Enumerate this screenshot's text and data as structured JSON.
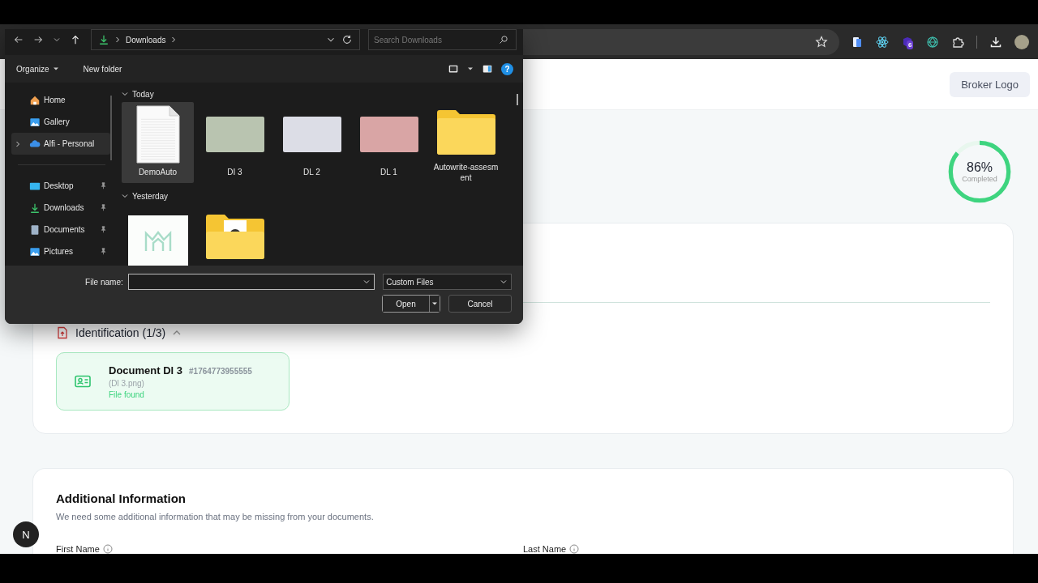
{
  "browser_toolbar": {
    "extension_badge": "6"
  },
  "dialog": {
    "breadcrumb": [
      "Downloads"
    ],
    "search": {
      "placeholder": "Search Downloads"
    },
    "toolbar": {
      "organize": "Organize",
      "new_folder": "New folder",
      "help": "?"
    },
    "sidebar": [
      {
        "label": "Home",
        "kind": "home",
        "pinned": false,
        "selected": false,
        "expandable": false
      },
      {
        "label": "Gallery",
        "kind": "gallery",
        "pinned": false,
        "selected": false,
        "expandable": false
      },
      {
        "label": "Alfi - Personal",
        "kind": "cloud",
        "pinned": false,
        "selected": true,
        "expandable": true
      },
      {
        "label": "Desktop",
        "kind": "desktop",
        "pinned": true,
        "selected": false,
        "expandable": false
      },
      {
        "label": "Downloads",
        "kind": "download",
        "pinned": true,
        "selected": false,
        "expandable": false
      },
      {
        "label": "Documents",
        "kind": "documents",
        "pinned": true,
        "selected": false,
        "expandable": false
      },
      {
        "label": "Pictures",
        "kind": "gallery",
        "pinned": true,
        "selected": false,
        "expandable": false
      }
    ],
    "groups": [
      {
        "title": "Today",
        "expanded": true,
        "items": [
          {
            "name": "DemoAuto",
            "kind": "document",
            "selected": true
          },
          {
            "name": "DI 3",
            "kind": "id-card",
            "selected": false,
            "color": "#b9c4b0"
          },
          {
            "name": "DL 2",
            "kind": "id-card",
            "selected": false,
            "color": "#dcdde6"
          },
          {
            "name": "DL 1",
            "kind": "id-card",
            "selected": false,
            "color": "#d9a5a5"
          },
          {
            "name": "Autowrite-assesment",
            "kind": "folder",
            "selected": false
          }
        ]
      },
      {
        "title": "Yesterday",
        "expanded": true,
        "items": [
          {
            "kind": "logo-image",
            "selected": false
          },
          {
            "kind": "folder-with-file",
            "selected": false
          }
        ]
      }
    ],
    "file_name": {
      "label": "File name:"
    },
    "file_type": "Custom Files",
    "buttons": {
      "open": "Open",
      "cancel": "Cancel"
    }
  },
  "page": {
    "broker_logo": "Broker Logo",
    "progress": {
      "level": 0.86,
      "percent": "86%",
      "caption": "Completed"
    },
    "identification": {
      "title": "Identification (1/3)",
      "expanded": true,
      "document": {
        "title": "Document Dl 3",
        "id": "#1764773955555",
        "file": "(Dl 3.png)",
        "status": "File found"
      }
    },
    "additional": {
      "title": "Additional Information",
      "subtitle": "We need some additional information that may be missing from your documents.",
      "fields": [
        "First Name",
        "Last Name"
      ]
    },
    "dev_badge": "N"
  }
}
